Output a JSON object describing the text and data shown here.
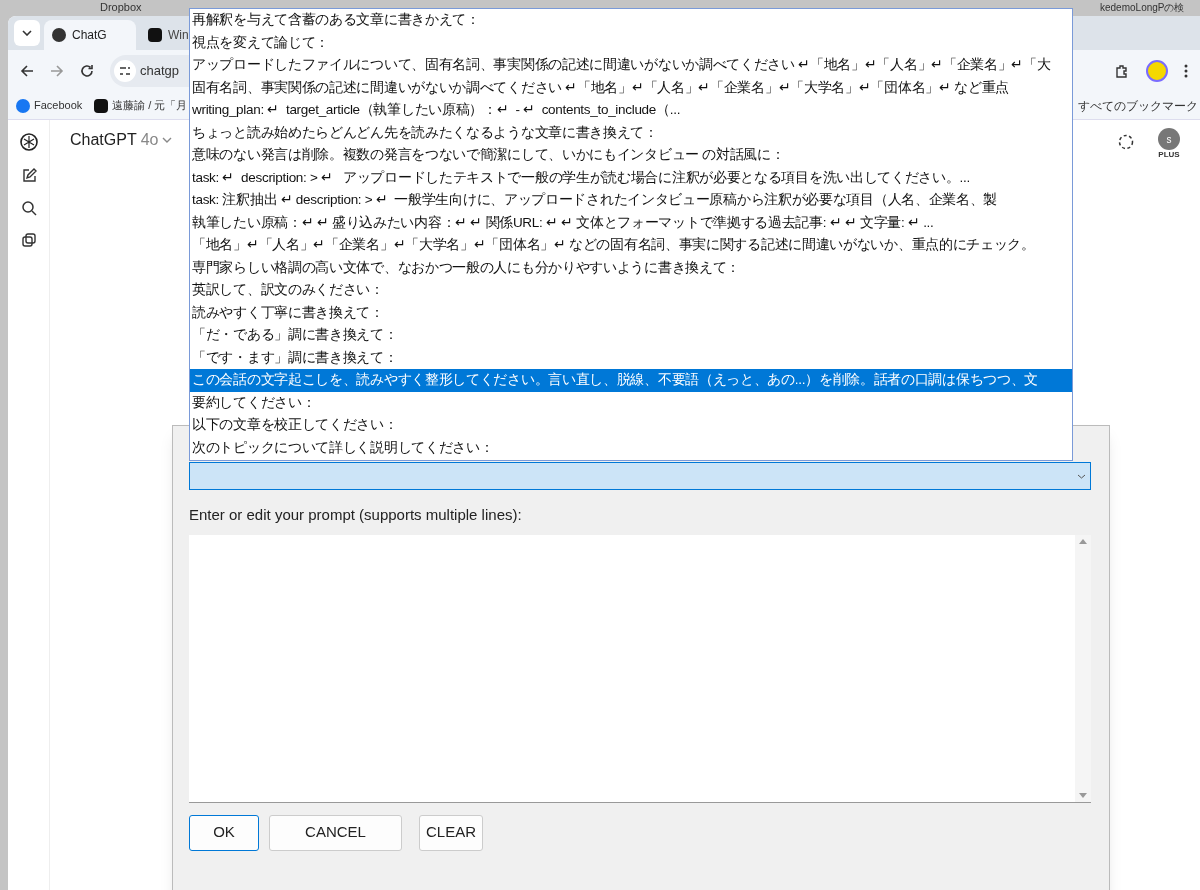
{
  "desktop": {
    "texts": [
      "Dropbox",
      "kedemoLongPの検"
    ]
  },
  "browser": {
    "tabs": [
      {
        "label": "ChatG",
        "selected": true
      },
      {
        "label": "Win",
        "selected": false
      }
    ],
    "address": "chatgp",
    "bookmarks": [
      "Facebook",
      "遠藤諭 / 元「月"
    ],
    "all_bookmarks": "すべてのブックマーク",
    "model": {
      "name": "ChatGPT",
      "version": "4o"
    },
    "avatar": {
      "initial": "s",
      "badge": "PLUS"
    }
  },
  "dialog": {
    "prompt_list": [
      {
        "text": "再解釈を与えて含蓄のある文章に書きかえて：",
        "selected": false
      },
      {
        "text": "視点を変えて論じて：",
        "selected": false
      },
      {
        "text": "アップロードしたファイルについて、固有名詞、事実関係の記述に間違いがないか調べてください ↵「地名」↵「人名」↵「企業名」↵「大",
        "selected": false
      },
      {
        "text": "固有名詞、事実関係の記述に間違いがないか調べてください ↵「地名」↵「人名」↵「企業名」↵「大学名」↵「団体名」↵ など重点",
        "selected": false
      },
      {
        "text": "writing_plan: ↵  target_article（執筆したい原稿）：↵  - ↵  contents_to_include（...",
        "selected": false
      },
      {
        "text": "ちょっと読み始めたらどんどん先を読みたくなるような文章に書き換えて：",
        "selected": false
      },
      {
        "text": "意味のない発言は削除。複数の発言をつないで簡潔にして、いかにもインタビュー の対話風に：",
        "selected": false
      },
      {
        "text": "task: ↵  description: > ↵   アップロードしたテキストで一般の学生が読む場合に注釈が必要となる項目を洗い出してください。...",
        "selected": false
      },
      {
        "text": "task: 注釈抽出 ↵ description: > ↵  一般学生向けに、アップロードされたインタビュー原稿から注釈が必要な項目（人名、企業名、製",
        "selected": false
      },
      {
        "text": "執筆したい原稿：↵ ↵ 盛り込みたい内容：↵ ↵ 関係URL: ↵ ↵ 文体とフォーマットで準拠する過去記事: ↵ ↵ 文字量: ↵ ...",
        "selected": false
      },
      {
        "text": "「地名」↵「人名」↵「企業名」↵「大学名」↵「団体名」↵ などの固有名詞、事実に関する記述に間違いがないか、重点的にチェック。",
        "selected": false
      },
      {
        "text": "専門家らしい格調の高い文体で、なおかつ一般の人にも分かりやすいように書き換えて：",
        "selected": false
      },
      {
        "text": "英訳して、訳文のみください：",
        "selected": false
      },
      {
        "text": "読みやすく丁寧に書き換えて：",
        "selected": false
      },
      {
        "text": "「だ・である」調に書き換えて：",
        "selected": false
      },
      {
        "text": "「です・ます」調に書き換えて：",
        "selected": false
      },
      {
        "text": "この会話の文字起こしを、読みやすく整形してください。言い直し、脱線、不要語（えっと、あの...）を削除。話者の口調は保ちつつ、文",
        "selected": true
      },
      {
        "text": "要約してください：",
        "selected": false
      },
      {
        "text": "以下の文章を校正してください：",
        "selected": false
      },
      {
        "text": "次のトピックについて詳しく説明してください：",
        "selected": false
      }
    ],
    "label": "Enter or edit your prompt (supports multiple lines):",
    "buttons": [
      {
        "label": "OK",
        "default": true
      },
      {
        "label": "CANCEL",
        "default": false
      },
      {
        "label": "CLEAR",
        "default": false
      }
    ]
  }
}
